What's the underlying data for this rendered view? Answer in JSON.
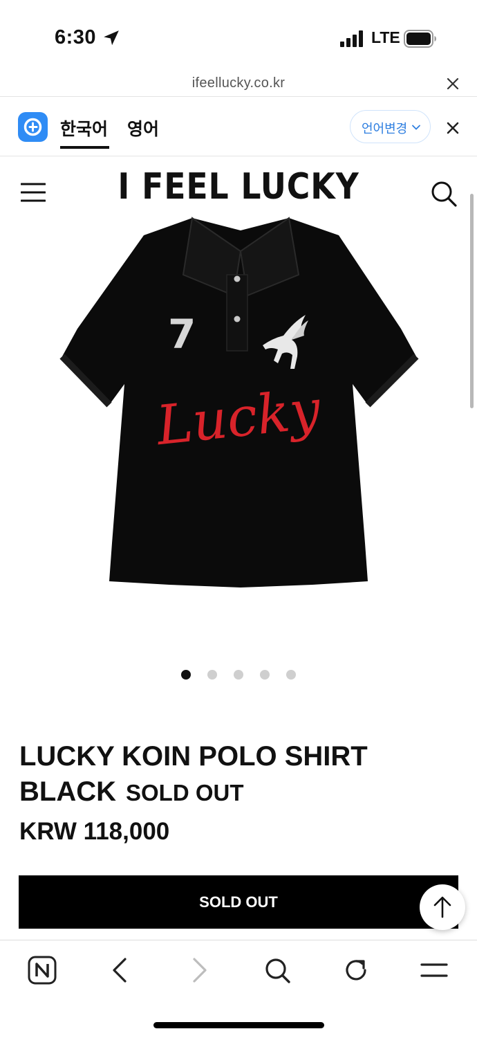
{
  "status_bar": {
    "time": "6:30",
    "network": "LTE"
  },
  "browser": {
    "url": "ifeellucky.co.kr"
  },
  "translate_bar": {
    "source_lang": "한국어",
    "target_lang": "영어",
    "change_label": "언어변경"
  },
  "site": {
    "logo": "I FEEL LUCKY"
  },
  "product": {
    "image_graphics": {
      "number": "7",
      "script": "Lucky"
    },
    "carousel": {
      "total": 5,
      "active": 1
    },
    "title": "LUCKY KOIN POLO SHIRT BLACK",
    "status_badge": "SOLD OUT",
    "price": "KRW 118,000",
    "button_label": "SOLD OUT"
  },
  "colors": {
    "accent_blue": "#2f8cf5",
    "script_red": "#d8232a",
    "shirt_black": "#0b0b0b"
  },
  "icons": [
    "location-arrow-icon",
    "signal-icon",
    "battery-icon",
    "close-icon",
    "translate-icon",
    "chevron-down-icon",
    "hamburger-icon",
    "search-icon",
    "arrow-up-icon",
    "naver-icon",
    "back-icon",
    "forward-icon",
    "refresh-icon",
    "menu-icon"
  ]
}
